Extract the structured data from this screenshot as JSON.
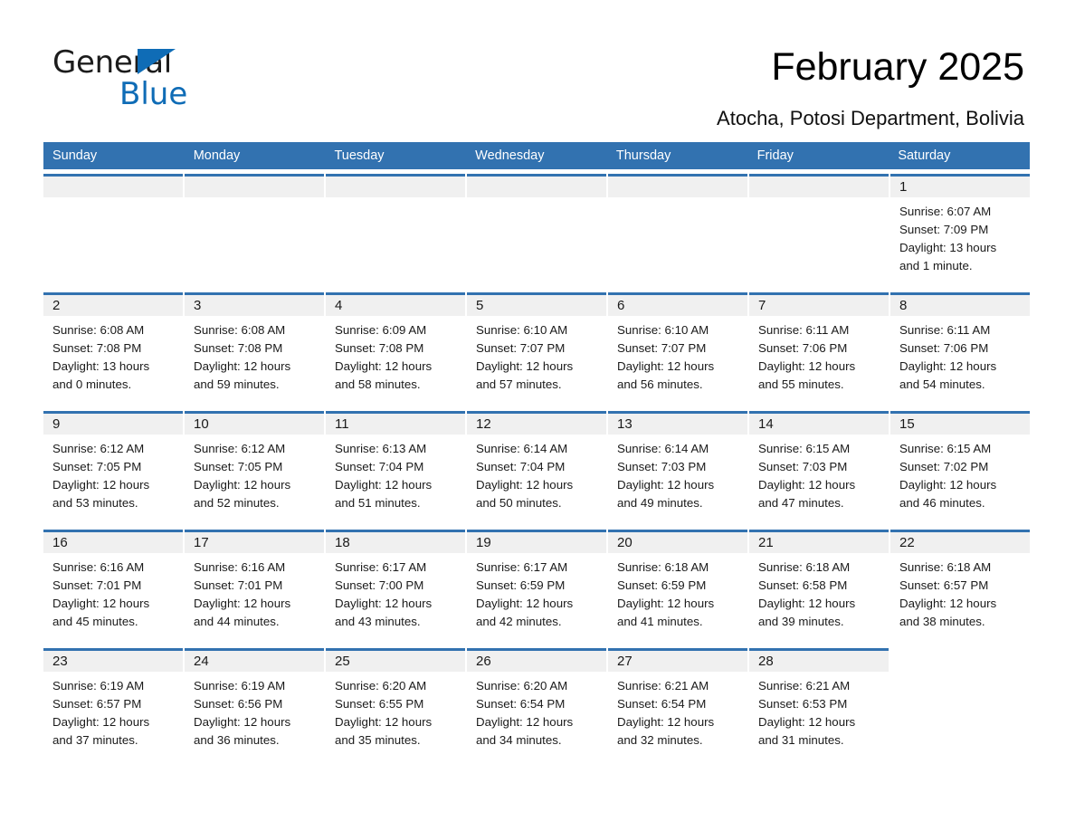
{
  "brand": {
    "name_part1": "General",
    "name_part2": "Blue",
    "accent_color": "#0f6cb6"
  },
  "header": {
    "title": "February 2025",
    "subtitle": "Atocha, Potosi Department, Bolivia",
    "header_bg_color": "#3272b0",
    "day_band_color": "#f0f0f0"
  },
  "weekdays": [
    "Sunday",
    "Monday",
    "Tuesday",
    "Wednesday",
    "Thursday",
    "Friday",
    "Saturday"
  ],
  "weeks": [
    [
      {
        "day": "",
        "sunrise": "",
        "sunset": "",
        "daylight_line1": "",
        "daylight_line2": "",
        "empty": true
      },
      {
        "day": "",
        "sunrise": "",
        "sunset": "",
        "daylight_line1": "",
        "daylight_line2": "",
        "empty": true
      },
      {
        "day": "",
        "sunrise": "",
        "sunset": "",
        "daylight_line1": "",
        "daylight_line2": "",
        "empty": true
      },
      {
        "day": "",
        "sunrise": "",
        "sunset": "",
        "daylight_line1": "",
        "daylight_line2": "",
        "empty": true
      },
      {
        "day": "",
        "sunrise": "",
        "sunset": "",
        "daylight_line1": "",
        "daylight_line2": "",
        "empty": true
      },
      {
        "day": "",
        "sunrise": "",
        "sunset": "",
        "daylight_line1": "",
        "daylight_line2": "",
        "empty": true
      },
      {
        "day": "1",
        "sunrise": "Sunrise: 6:07 AM",
        "sunset": "Sunset: 7:09 PM",
        "daylight_line1": "Daylight: 13 hours",
        "daylight_line2": "and 1 minute.",
        "empty": false
      }
    ],
    [
      {
        "day": "2",
        "sunrise": "Sunrise: 6:08 AM",
        "sunset": "Sunset: 7:08 PM",
        "daylight_line1": "Daylight: 13 hours",
        "daylight_line2": "and 0 minutes.",
        "empty": false
      },
      {
        "day": "3",
        "sunrise": "Sunrise: 6:08 AM",
        "sunset": "Sunset: 7:08 PM",
        "daylight_line1": "Daylight: 12 hours",
        "daylight_line2": "and 59 minutes.",
        "empty": false
      },
      {
        "day": "4",
        "sunrise": "Sunrise: 6:09 AM",
        "sunset": "Sunset: 7:08 PM",
        "daylight_line1": "Daylight: 12 hours",
        "daylight_line2": "and 58 minutes.",
        "empty": false
      },
      {
        "day": "5",
        "sunrise": "Sunrise: 6:10 AM",
        "sunset": "Sunset: 7:07 PM",
        "daylight_line1": "Daylight: 12 hours",
        "daylight_line2": "and 57 minutes.",
        "empty": false
      },
      {
        "day": "6",
        "sunrise": "Sunrise: 6:10 AM",
        "sunset": "Sunset: 7:07 PM",
        "daylight_line1": "Daylight: 12 hours",
        "daylight_line2": "and 56 minutes.",
        "empty": false
      },
      {
        "day": "7",
        "sunrise": "Sunrise: 6:11 AM",
        "sunset": "Sunset: 7:06 PM",
        "daylight_line1": "Daylight: 12 hours",
        "daylight_line2": "and 55 minutes.",
        "empty": false
      },
      {
        "day": "8",
        "sunrise": "Sunrise: 6:11 AM",
        "sunset": "Sunset: 7:06 PM",
        "daylight_line1": "Daylight: 12 hours",
        "daylight_line2": "and 54 minutes.",
        "empty": false
      }
    ],
    [
      {
        "day": "9",
        "sunrise": "Sunrise: 6:12 AM",
        "sunset": "Sunset: 7:05 PM",
        "daylight_line1": "Daylight: 12 hours",
        "daylight_line2": "and 53 minutes.",
        "empty": false
      },
      {
        "day": "10",
        "sunrise": "Sunrise: 6:12 AM",
        "sunset": "Sunset: 7:05 PM",
        "daylight_line1": "Daylight: 12 hours",
        "daylight_line2": "and 52 minutes.",
        "empty": false
      },
      {
        "day": "11",
        "sunrise": "Sunrise: 6:13 AM",
        "sunset": "Sunset: 7:04 PM",
        "daylight_line1": "Daylight: 12 hours",
        "daylight_line2": "and 51 minutes.",
        "empty": false
      },
      {
        "day": "12",
        "sunrise": "Sunrise: 6:14 AM",
        "sunset": "Sunset: 7:04 PM",
        "daylight_line1": "Daylight: 12 hours",
        "daylight_line2": "and 50 minutes.",
        "empty": false
      },
      {
        "day": "13",
        "sunrise": "Sunrise: 6:14 AM",
        "sunset": "Sunset: 7:03 PM",
        "daylight_line1": "Daylight: 12 hours",
        "daylight_line2": "and 49 minutes.",
        "empty": false
      },
      {
        "day": "14",
        "sunrise": "Sunrise: 6:15 AM",
        "sunset": "Sunset: 7:03 PM",
        "daylight_line1": "Daylight: 12 hours",
        "daylight_line2": "and 47 minutes.",
        "empty": false
      },
      {
        "day": "15",
        "sunrise": "Sunrise: 6:15 AM",
        "sunset": "Sunset: 7:02 PM",
        "daylight_line1": "Daylight: 12 hours",
        "daylight_line2": "and 46 minutes.",
        "empty": false
      }
    ],
    [
      {
        "day": "16",
        "sunrise": "Sunrise: 6:16 AM",
        "sunset": "Sunset: 7:01 PM",
        "daylight_line1": "Daylight: 12 hours",
        "daylight_line2": "and 45 minutes.",
        "empty": false
      },
      {
        "day": "17",
        "sunrise": "Sunrise: 6:16 AM",
        "sunset": "Sunset: 7:01 PM",
        "daylight_line1": "Daylight: 12 hours",
        "daylight_line2": "and 44 minutes.",
        "empty": false
      },
      {
        "day": "18",
        "sunrise": "Sunrise: 6:17 AM",
        "sunset": "Sunset: 7:00 PM",
        "daylight_line1": "Daylight: 12 hours",
        "daylight_line2": "and 43 minutes.",
        "empty": false
      },
      {
        "day": "19",
        "sunrise": "Sunrise: 6:17 AM",
        "sunset": "Sunset: 6:59 PM",
        "daylight_line1": "Daylight: 12 hours",
        "daylight_line2": "and 42 minutes.",
        "empty": false
      },
      {
        "day": "20",
        "sunrise": "Sunrise: 6:18 AM",
        "sunset": "Sunset: 6:59 PM",
        "daylight_line1": "Daylight: 12 hours",
        "daylight_line2": "and 41 minutes.",
        "empty": false
      },
      {
        "day": "21",
        "sunrise": "Sunrise: 6:18 AM",
        "sunset": "Sunset: 6:58 PM",
        "daylight_line1": "Daylight: 12 hours",
        "daylight_line2": "and 39 minutes.",
        "empty": false
      },
      {
        "day": "22",
        "sunrise": "Sunrise: 6:18 AM",
        "sunset": "Sunset: 6:57 PM",
        "daylight_line1": "Daylight: 12 hours",
        "daylight_line2": "and 38 minutes.",
        "empty": false
      }
    ],
    [
      {
        "day": "23",
        "sunrise": "Sunrise: 6:19 AM",
        "sunset": "Sunset: 6:57 PM",
        "daylight_line1": "Daylight: 12 hours",
        "daylight_line2": "and 37 minutes.",
        "empty": false
      },
      {
        "day": "24",
        "sunrise": "Sunrise: 6:19 AM",
        "sunset": "Sunset: 6:56 PM",
        "daylight_line1": "Daylight: 12 hours",
        "daylight_line2": "and 36 minutes.",
        "empty": false
      },
      {
        "day": "25",
        "sunrise": "Sunrise: 6:20 AM",
        "sunset": "Sunset: 6:55 PM",
        "daylight_line1": "Daylight: 12 hours",
        "daylight_line2": "and 35 minutes.",
        "empty": false
      },
      {
        "day": "26",
        "sunrise": "Sunrise: 6:20 AM",
        "sunset": "Sunset: 6:54 PM",
        "daylight_line1": "Daylight: 12 hours",
        "daylight_line2": "and 34 minutes.",
        "empty": false
      },
      {
        "day": "27",
        "sunrise": "Sunrise: 6:21 AM",
        "sunset": "Sunset: 6:54 PM",
        "daylight_line1": "Daylight: 12 hours",
        "daylight_line2": "and 32 minutes.",
        "empty": false
      },
      {
        "day": "28",
        "sunrise": "Sunrise: 6:21 AM",
        "sunset": "Sunset: 6:53 PM",
        "daylight_line1": "Daylight: 12 hours",
        "daylight_line2": "and 31 minutes.",
        "empty": false
      },
      {
        "day": "",
        "sunrise": "",
        "sunset": "",
        "daylight_line1": "",
        "daylight_line2": "",
        "empty": true
      }
    ]
  ]
}
